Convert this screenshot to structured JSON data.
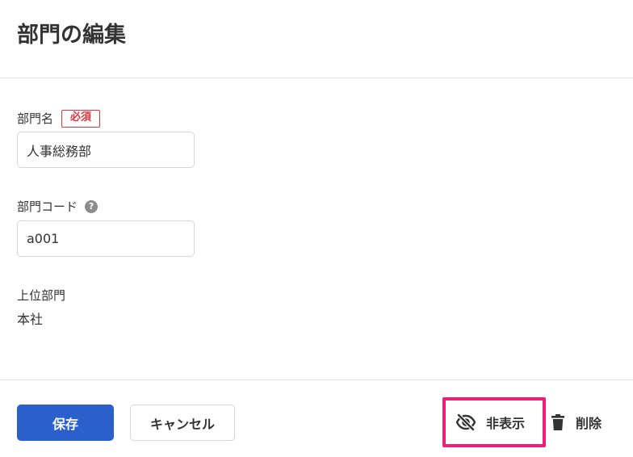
{
  "header": {
    "title": "部門の編集"
  },
  "form": {
    "department_name": {
      "label": "部門名",
      "required_badge": "必須",
      "value": "人事総務部"
    },
    "department_code": {
      "label": "部門コード",
      "help_icon": "?",
      "value": "a001"
    },
    "parent_department": {
      "label": "上位部門",
      "value": "本社"
    }
  },
  "footer": {
    "save_label": "保存",
    "cancel_label": "キャンセル",
    "hide_label": "非表示",
    "delete_label": "削除"
  },
  "icons": {
    "hide": "eye-off-icon",
    "delete": "trash-icon",
    "help": "question-circle-icon"
  },
  "colors": {
    "primary": "#2b5fcc",
    "required": "#d9363e",
    "highlight": "#ee1f78"
  }
}
